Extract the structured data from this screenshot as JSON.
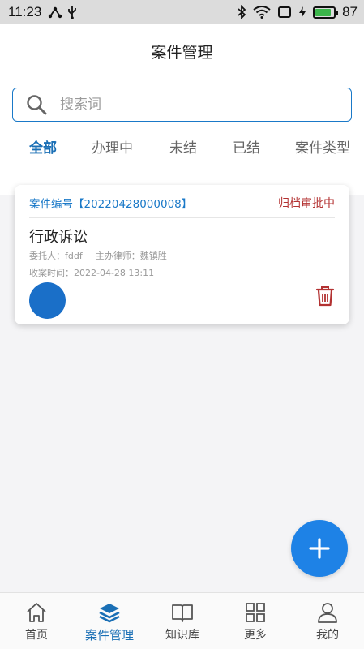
{
  "status_bar": {
    "time": "11:23",
    "battery_level": "87",
    "battery_color": "#3bb54a"
  },
  "header": {
    "title": "案件管理"
  },
  "search": {
    "placeholder": "搜索词",
    "value": ""
  },
  "tabs": [
    {
      "label": "全部",
      "active": true
    },
    {
      "label": "办理中",
      "active": false
    },
    {
      "label": "未结",
      "active": false
    },
    {
      "label": "已结",
      "active": false
    },
    {
      "label": "案件类型",
      "active": false
    }
  ],
  "cases": [
    {
      "case_no_label": "案件编号【20220428000008】",
      "status": "归档审批中",
      "type": "行政诉讼",
      "client_label": "委托人：",
      "client": "fddf",
      "lawyer_label": "主办律师：",
      "lawyer": "魏镇胜",
      "received_label": "收案时间：",
      "received": "2022-04-28 13:11"
    }
  ],
  "bottom_nav": [
    {
      "label": "首页",
      "icon": "home-icon",
      "active": false
    },
    {
      "label": "案件管理",
      "icon": "layers-icon",
      "active": true
    },
    {
      "label": "知识库",
      "icon": "book-icon",
      "active": false
    },
    {
      "label": "更多",
      "icon": "grid-icon",
      "active": false
    },
    {
      "label": "我的",
      "icon": "user-icon",
      "active": false
    }
  ],
  "colors": {
    "accent": "#1a6fb5",
    "status_red": "#b33232",
    "fab": "#1e82e6"
  }
}
